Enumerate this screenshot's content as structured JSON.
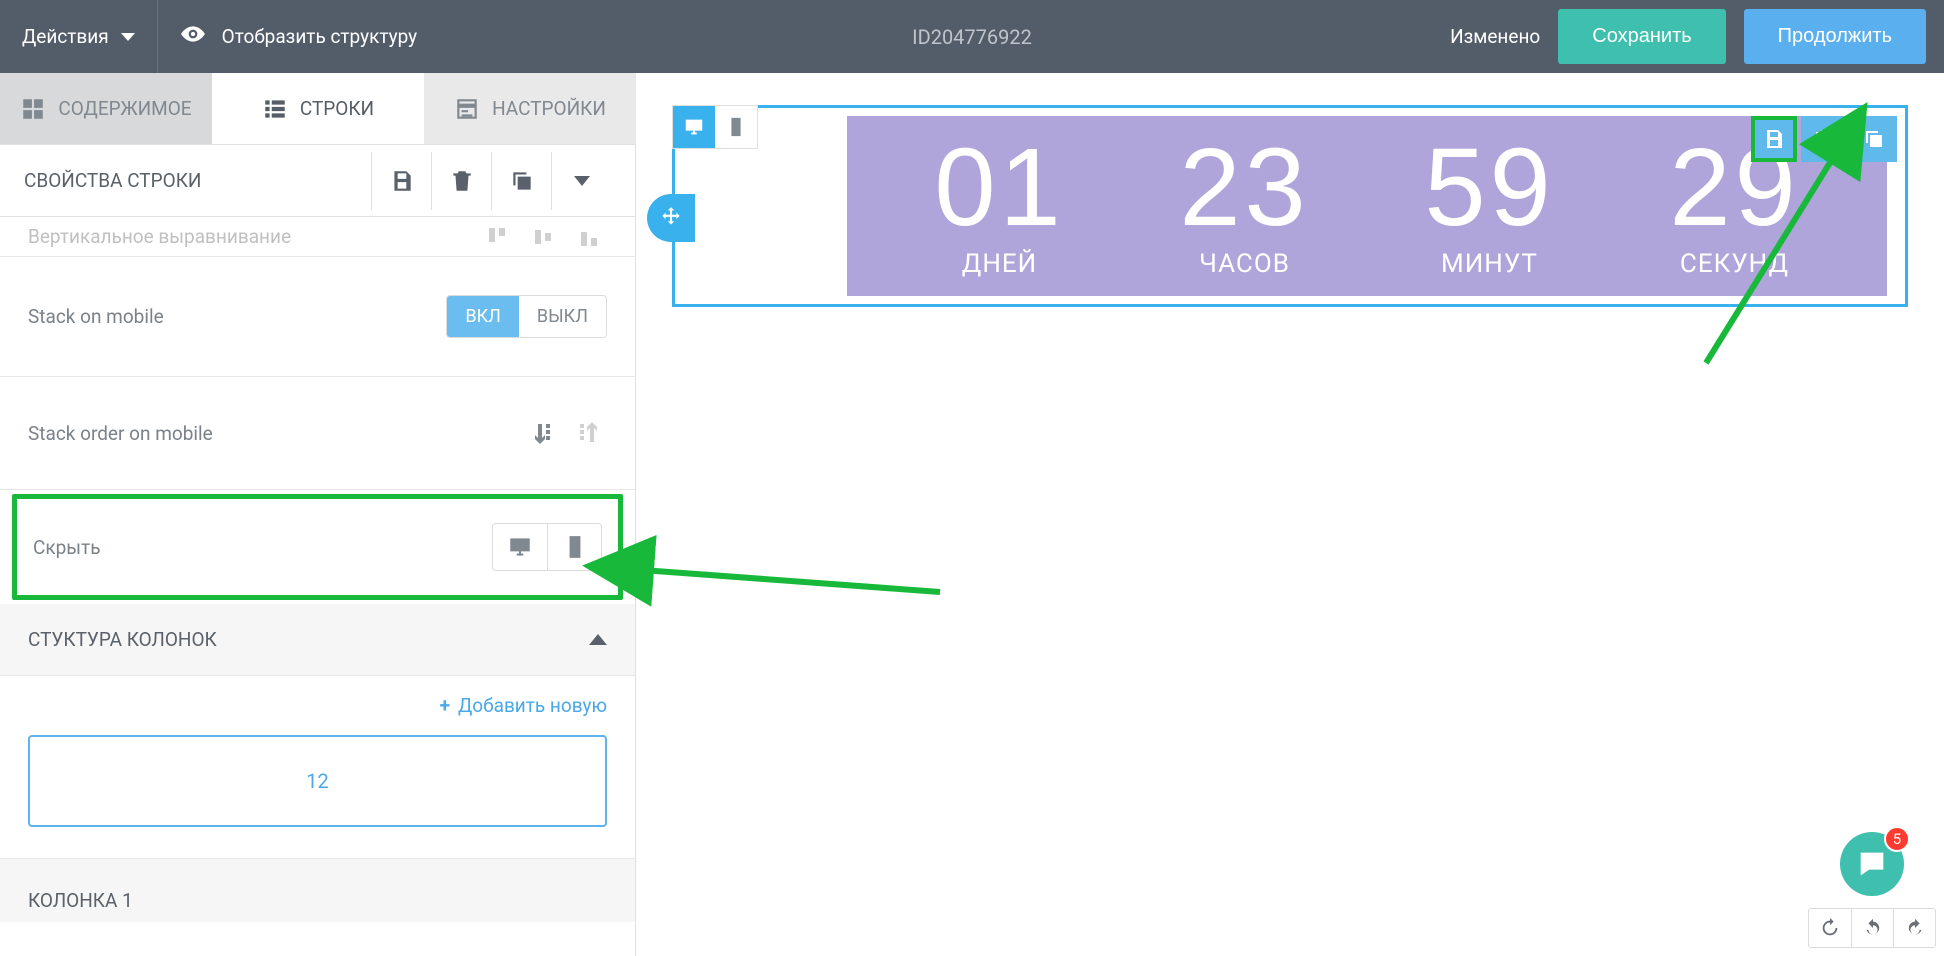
{
  "topbar": {
    "actions": "Действия",
    "show_structure": "Отобразить структуру",
    "id": "ID204776922",
    "status": "Изменено",
    "save": "Сохранить",
    "continue": "Продолжить"
  },
  "tabs": {
    "content": "СОДЕРЖИМОЕ",
    "rows": "СТРОКИ",
    "settings": "НАСТРОЙКИ"
  },
  "sidebar": {
    "row_properties": "СВОЙСТВА СТРОКИ",
    "vertical_align": "Вертикальное выравнивание",
    "stack_on_mobile": "Stack on mobile",
    "toggle_on": "ВКЛ",
    "toggle_off": "ВЫКЛ",
    "stack_order": "Stack order on mobile",
    "hide": "Скрыть",
    "column_structure": "СТУКТУРА КОЛОНОК",
    "add_new": "Добавить новую",
    "col_value": "12",
    "column1": "КОЛОНКА 1"
  },
  "countdown": {
    "days_v": "01",
    "days_l": "ДНЕЙ",
    "hours_v": "23",
    "hours_l": "ЧАСОВ",
    "mins_v": "59",
    "mins_l": "МИНУТ",
    "secs_v": "29",
    "secs_l": "СЕКУНД"
  },
  "chat": {
    "badge": "5"
  }
}
